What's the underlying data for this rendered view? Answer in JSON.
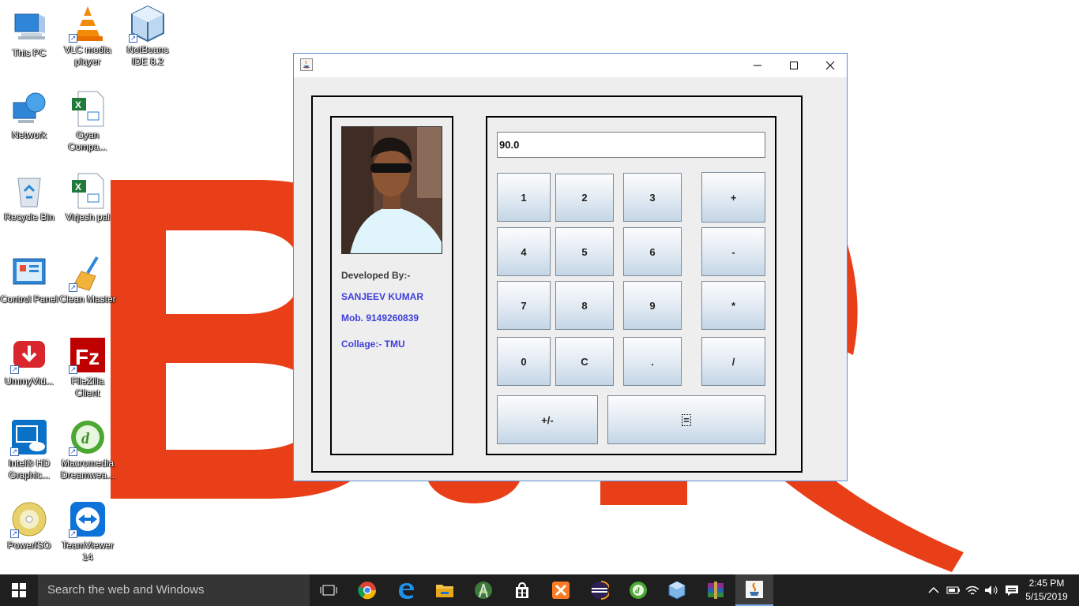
{
  "desktop": {
    "icons": [
      {
        "label": "This PC",
        "icon": "computer-icon",
        "shortcut": false
      },
      {
        "label": "VLC media player",
        "icon": "vlc-icon",
        "shortcut": true
      },
      {
        "label": "NetBeans IDE 8.2",
        "icon": "netbeans-icon",
        "shortcut": true
      },
      {
        "label": "Network",
        "icon": "network-icon",
        "shortcut": false
      },
      {
        "label": "Gyan Compa...",
        "icon": "excel-file-icon",
        "shortcut": false
      },
      {
        "label": "Recycle Bin",
        "icon": "recycle-bin-icon",
        "shortcut": false
      },
      {
        "label": "Virjesh pal",
        "icon": "excel-file-icon",
        "shortcut": false
      },
      {
        "label": "Control Panel",
        "icon": "control-panel-icon",
        "shortcut": false
      },
      {
        "label": "Clean Master",
        "icon": "clean-master-icon",
        "shortcut": true
      },
      {
        "label": "UmmyVid...",
        "icon": "ummy-video-icon",
        "shortcut": true
      },
      {
        "label": "FileZilla Client",
        "icon": "filezilla-icon",
        "shortcut": true
      },
      {
        "label": "Intel® HD Graphic...",
        "icon": "intel-graphics-icon",
        "shortcut": true
      },
      {
        "label": "Macromedia Dreamwea...",
        "icon": "dreamweaver-icon",
        "shortcut": true
      },
      {
        "label": "PowerISO",
        "icon": "poweriso-icon",
        "shortcut": true
      },
      {
        "label": "TeamViewer 14",
        "icon": "teamviewer-icon",
        "shortcut": true
      }
    ]
  },
  "window": {
    "title": "",
    "developer": {
      "developed_by": "Developed By:-",
      "name": "SANJEEV KUMAR",
      "mobile": "Mob. 9149260839",
      "college": "Collage:- TMU"
    },
    "calculator": {
      "display_value": "90.0",
      "keys": [
        "1",
        "2",
        "3",
        "+",
        "4",
        "5",
        "6",
        "-",
        "7",
        "8",
        "9",
        "*",
        "0",
        "C",
        ".",
        "/",
        "+/-",
        "="
      ]
    }
  },
  "taskbar": {
    "search_placeholder": "Search the web and Windows",
    "apps": [
      "task-view-icon",
      "chrome-icon",
      "edge-icon",
      "file-explorer-icon",
      "android-studio-icon",
      "store-icon",
      "xampp-icon",
      "eclipse-icon",
      "dreamweaver-icon",
      "virtualbox-icon",
      "winrar-icon",
      "java-icon"
    ],
    "time": "2:45 PM",
    "date": "5/15/2019"
  },
  "colors": {
    "accent_blue": "#3e3edb",
    "taskbar": "#1f1f1f",
    "wallpaper_letters": "#e8350c"
  }
}
